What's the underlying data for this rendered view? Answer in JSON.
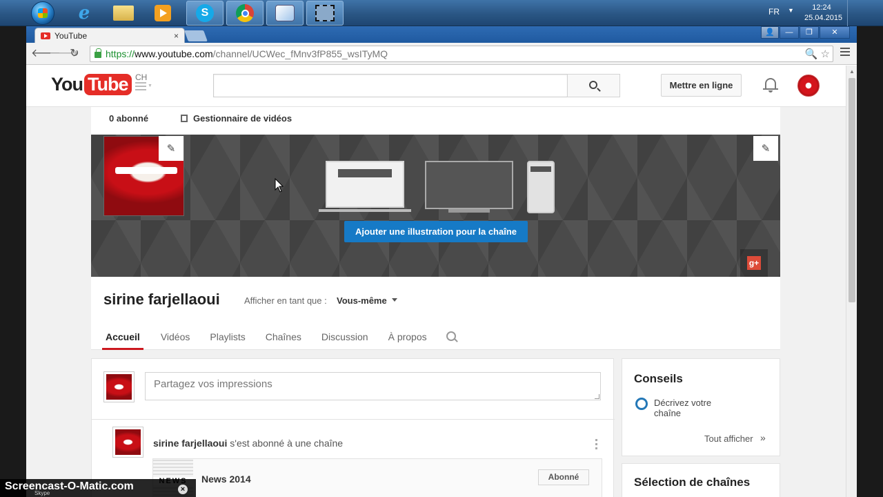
{
  "taskbar": {
    "lang": "FR",
    "time": "12:24",
    "date": "25.04.2015",
    "icons": [
      "ie-icon",
      "explorer-icon",
      "media-player-icon",
      "skype-icon",
      "chrome-icon",
      "paint-icon",
      "screencast-icon"
    ]
  },
  "browser": {
    "tab_title": "YouTube",
    "tab_close": "×",
    "url_scheme": "https://",
    "url_host": "www.youtube.com",
    "url_path": "/channel/UCWec_fMnv3fP855_wsITyMQ",
    "win_minimize": "—",
    "win_restore": "❐",
    "win_close": "✕"
  },
  "masthead": {
    "logo_you": "You",
    "logo_tube": "Tube",
    "country": "CH",
    "search_placeholder": "",
    "upload_label": "Mettre en ligne"
  },
  "channel": {
    "subscribers": "0 abonné",
    "video_manager": "Gestionnaire de vidéos",
    "add_art_label": "Ajouter une illustration pour la chaîne",
    "gplus": "g+",
    "name": "sirine farjellaoui",
    "view_as_label": "Afficher en tant que :",
    "view_as_value": "Vous-même",
    "tabs": [
      {
        "label": "Accueil"
      },
      {
        "label": "Vidéos"
      },
      {
        "label": "Playlists"
      },
      {
        "label": "Chaînes"
      },
      {
        "label": "Discussion"
      },
      {
        "label": "À propos"
      }
    ]
  },
  "feed": {
    "share_placeholder": "Partagez vos impressions",
    "activity_user": "sirine farjellaoui",
    "activity_action": " s'est abonné à une chaîne",
    "sub_channel_thumb": "NEWS",
    "sub_channel_title": "News 2014",
    "sub_button": "Abonné"
  },
  "sidebar": {
    "tips_title": "Conseils",
    "tip_text": "Décrivez votre chaîne",
    "see_all": "Tout afficher",
    "see_all_arrow": "»",
    "channels_title": "Sélection de chaînes"
  },
  "watermark": {
    "text": "Screencast-O-Matic.com",
    "sub": "Skype",
    "close": "×"
  },
  "colors": {
    "yt_red": "#e52d27",
    "accent_blue": "#167ac6",
    "tab_active": "#cc181e"
  }
}
